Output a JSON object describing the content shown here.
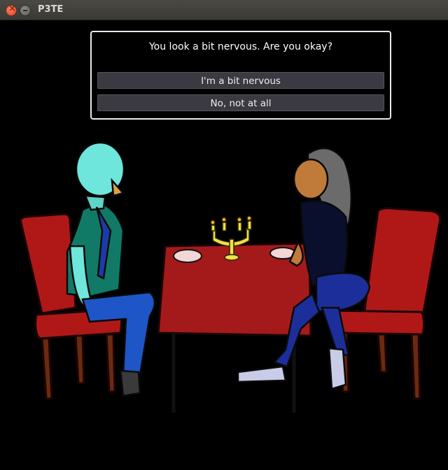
{
  "window": {
    "title": "P3TE"
  },
  "icons": {
    "close": "close-icon",
    "minimize": "minimize-icon"
  },
  "dialog": {
    "prompt": "You look a bit nervous. Are you okay?",
    "choices": [
      {
        "label": "I'm a bit nervous"
      },
      {
        "label": "No, not at all"
      }
    ]
  },
  "colors": {
    "background": "#000000",
    "chair_red": "#b01818",
    "tablecloth_red": "#a41a1a",
    "choice_bg": "#3b3a42",
    "dialog_border": "#e8e8e8"
  }
}
